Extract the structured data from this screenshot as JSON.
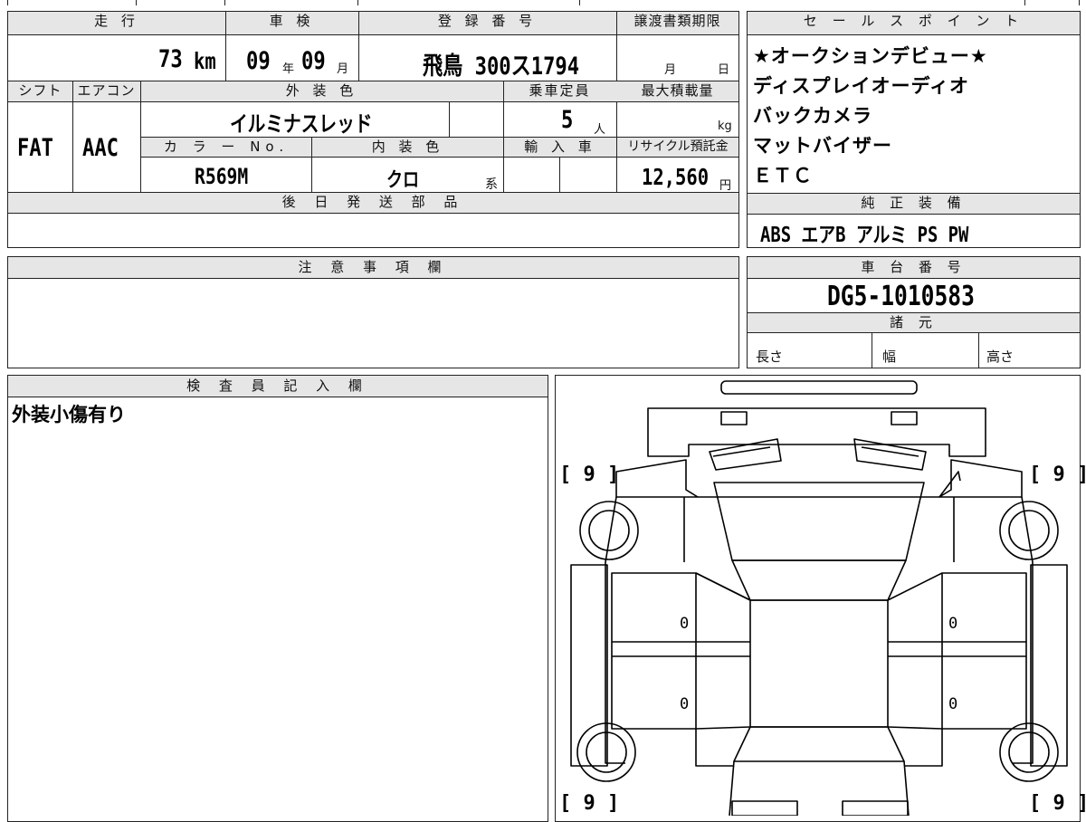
{
  "main": {
    "headers": {
      "mileage": "走 行",
      "inspection": "車 検",
      "registration": "登 録 番 号",
      "transfer_docs": "譲渡書類期限",
      "shift": "シフト",
      "aircon": "エアコン",
      "exterior_color": "外 装 色",
      "capacity": "乗車定員",
      "max_load": "最大積載量",
      "color_no": "カ ラ ー No.",
      "interior_color": "内 装 色",
      "import": "輸 入 車",
      "recycle": "リサイクル預託金",
      "later_parts": "後 日 発 送 部 品"
    },
    "mileage": {
      "value": "73",
      "unit": "km"
    },
    "inspection": {
      "year": "09",
      "year_unit": "年",
      "month": "09",
      "month_unit": "月"
    },
    "registration": "飛鳥 300ス1794",
    "transfer_docs": {
      "month_unit": "月",
      "day_unit": "日"
    },
    "shift": "FAT",
    "aircon": "AAC",
    "exterior_color": "イルミナスレッド",
    "capacity": {
      "value": "5",
      "unit": "人"
    },
    "max_load": {
      "unit": "kg"
    },
    "color_no": "R569M",
    "interior_color": {
      "value": "クロ",
      "suffix": "系"
    },
    "recycle": {
      "value": "12,560",
      "unit": "円"
    }
  },
  "sales_points": {
    "header": "セ ー ル ス ポ イ ン ト",
    "items": [
      "★オークションデビュー★",
      "ディスプレイオーディオ",
      "バックカメラ",
      "マットバイザー",
      "ＥＴＣ"
    ]
  },
  "equipment": {
    "header": "純 正 装 備",
    "items": "ABS エアB アルミ PS PW"
  },
  "notes": {
    "header": "注 意 事 項 欄"
  },
  "chassis": {
    "header": "車 台 番 号",
    "value": "DG5-1010583"
  },
  "specs": {
    "header": "諸 元",
    "length": "長さ",
    "width": "幅",
    "height": "高さ"
  },
  "inspector": {
    "header": "検 査 員 記 入 欄",
    "comment": "外装小傷有り"
  },
  "diagram": {
    "tire_fl": "[ 9 ]",
    "tire_fr": "[ 9 ]",
    "tire_rl": "[ 9 ]",
    "tire_rr": "[ 9 ]",
    "door_fl": "0",
    "door_rl": "0",
    "door_fr": "0",
    "door_rr": "0"
  }
}
